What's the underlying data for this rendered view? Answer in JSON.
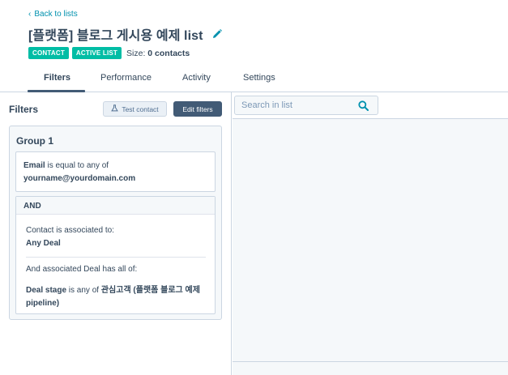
{
  "header": {
    "back_label": "Back to lists",
    "title": "[플랫폼] 블로그 게시용 예제 list",
    "tags": [
      "CONTACT",
      "ACTIVE LIST"
    ],
    "size_label": "Size:",
    "size_value": "0 contacts"
  },
  "tabs": [
    {
      "label": "Filters",
      "active": true
    },
    {
      "label": "Performance",
      "active": false
    },
    {
      "label": "Activity",
      "active": false
    },
    {
      "label": "Settings",
      "active": false
    }
  ],
  "filters_panel": {
    "title": "Filters",
    "test_contact_label": "Test contact",
    "edit_filters_label": "Edit filters",
    "group": {
      "title": "Group 1",
      "email_filter": {
        "property": "Email",
        "operator": " is equal to any of",
        "value": "yourname@yourdomain.com"
      },
      "and_block": {
        "label": "AND",
        "association_text": "Contact is associated to:",
        "association_value": "Any Deal",
        "associated_text": "And associated Deal has all of:",
        "deal_property": "Deal stage",
        "deal_operator": " is any of ",
        "deal_value": "관심고객 (플랫폼 블로그 예제 pipeline)"
      }
    }
  },
  "search": {
    "placeholder": "Search in list",
    "value": ""
  },
  "colors": {
    "accent": "#0091ae",
    "tag": "#00bda5",
    "primary_button": "#425b76",
    "text": "#33475b"
  }
}
